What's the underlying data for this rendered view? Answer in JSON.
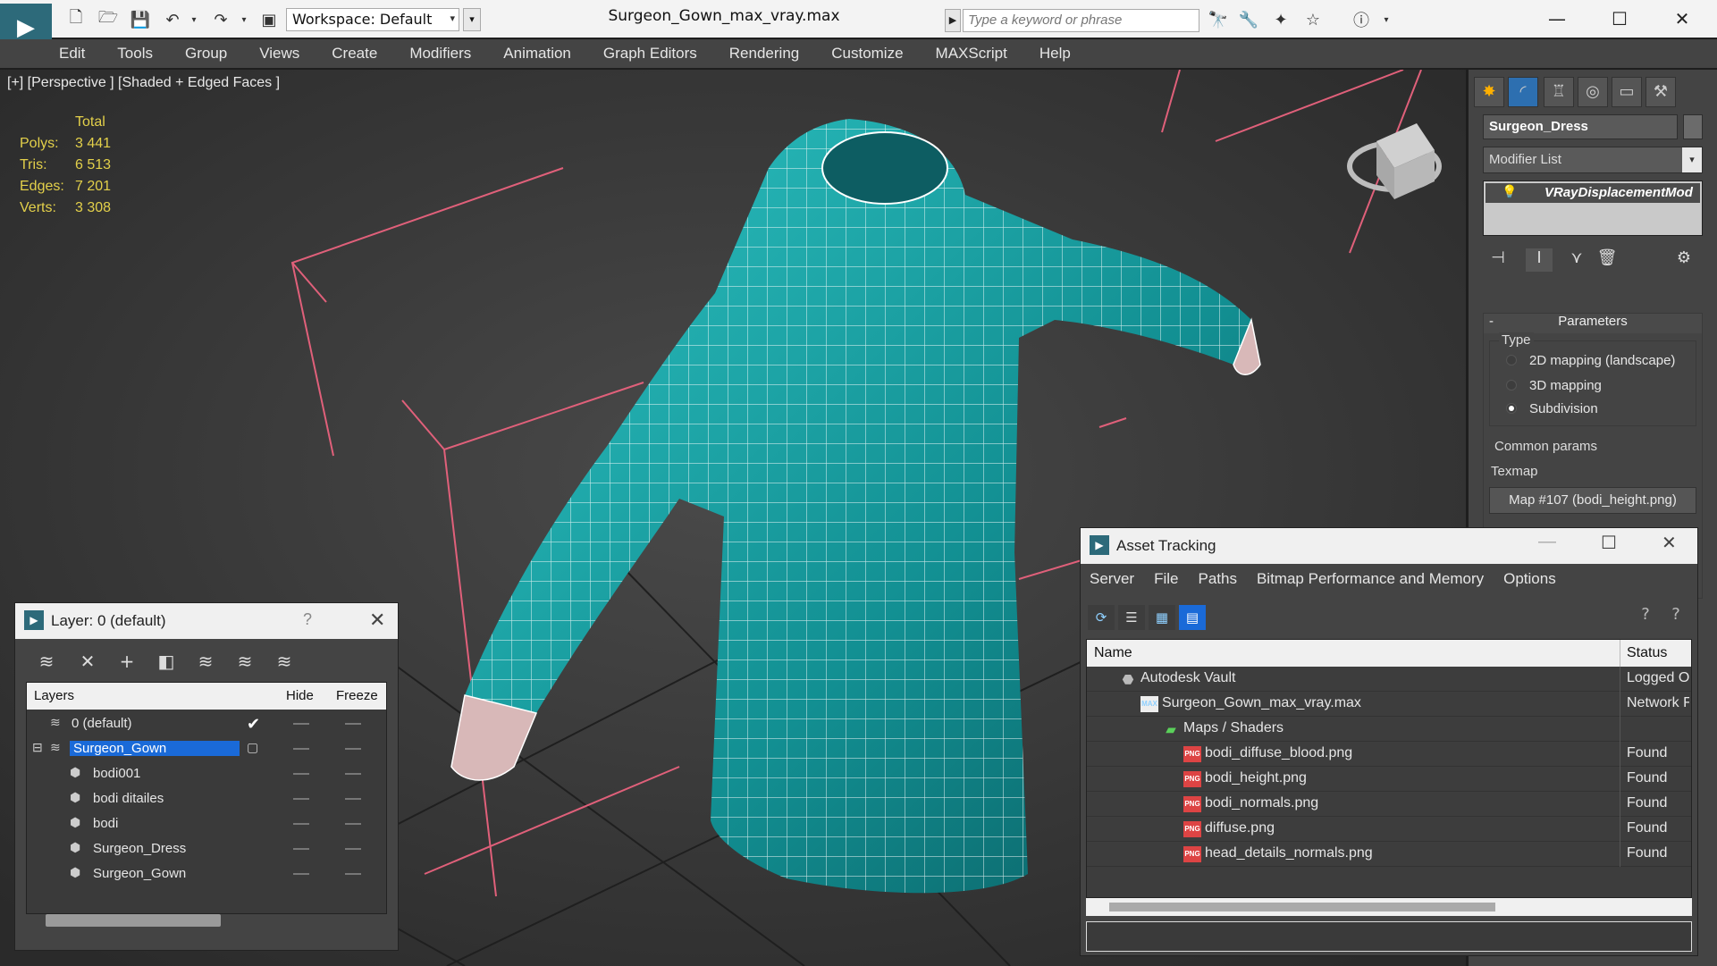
{
  "titlebar": {
    "workspace_label": "Workspace: Default",
    "document_title": "Surgeon_Gown_max_vray.max",
    "search_placeholder": "Type a keyword or phrase"
  },
  "menubar": {
    "items": [
      "Edit",
      "Tools",
      "Group",
      "Views",
      "Create",
      "Modifiers",
      "Animation",
      "Graph Editors",
      "Rendering",
      "Customize",
      "MAXScript",
      "Help"
    ]
  },
  "viewport": {
    "label": "[+] [Perspective ] [Shaded + Edged Faces ]",
    "stats": {
      "header": "Total",
      "rows": [
        {
          "label": "Polys:",
          "value": "3 441"
        },
        {
          "label": "Tris:",
          "value": "6 513"
        },
        {
          "label": "Edges:",
          "value": "7 201"
        },
        {
          "label": "Verts:",
          "value": "3 308"
        }
      ]
    },
    "mesh_color": "#1fa3a3",
    "wire_color": "#ffffff",
    "bbox_color": "#e0607a"
  },
  "command_panel": {
    "object_name": "Surgeon_Dress",
    "modifier_list": "Modifier List",
    "stack_item": "VRayDisplacementMod",
    "parameters_title": "Parameters",
    "type_label": "Type",
    "type_options": [
      {
        "label": "2D mapping (landscape)",
        "selected": false
      },
      {
        "label": "3D mapping",
        "selected": false
      },
      {
        "label": "Subdivision",
        "selected": true
      }
    ],
    "common_params": "Common params",
    "texmap_label": "Texmap",
    "map_button": "Map #107 (bodi_height.png)"
  },
  "layer_window": {
    "title": "Layer: 0 (default)",
    "help": "?",
    "columns": {
      "layers": "Layers",
      "hide": "Hide",
      "freeze": "Freeze"
    },
    "rows": [
      {
        "name": "0 (default)",
        "type": "layer",
        "indent": 1,
        "current": true,
        "selected": false
      },
      {
        "name": "Surgeon_Gown",
        "type": "layer",
        "indent": 1,
        "current": false,
        "selected": true
      },
      {
        "name": "bodi001",
        "type": "object",
        "indent": 2,
        "current": false,
        "selected": false
      },
      {
        "name": "bodi ditailes",
        "type": "object",
        "indent": 2,
        "current": false,
        "selected": false
      },
      {
        "name": "bodi",
        "type": "object",
        "indent": 2,
        "current": false,
        "selected": false
      },
      {
        "name": "Surgeon_Dress",
        "type": "object",
        "indent": 2,
        "current": false,
        "selected": false
      },
      {
        "name": "Surgeon_Gown",
        "type": "object",
        "indent": 2,
        "current": false,
        "selected": false
      }
    ]
  },
  "asset_window": {
    "title": "Asset Tracking",
    "menu": [
      "Server",
      "File",
      "Paths",
      "Bitmap Performance and Memory",
      "Options"
    ],
    "columns": {
      "name": "Name",
      "status": "Status"
    },
    "rows": [
      {
        "name": "Autodesk Vault",
        "status": "Logged O",
        "indent": 0,
        "icon": "vault"
      },
      {
        "name": "Surgeon_Gown_max_vray.max",
        "status": "Network F",
        "indent": 1,
        "icon": "max"
      },
      {
        "name": "Maps / Shaders",
        "status": "",
        "indent": 2,
        "icon": "folder"
      },
      {
        "name": "bodi_diffuse_blood.png",
        "status": "Found",
        "indent": 3,
        "icon": "png"
      },
      {
        "name": "bodi_height.png",
        "status": "Found",
        "indent": 3,
        "icon": "png"
      },
      {
        "name": "bodi_normals.png",
        "status": "Found",
        "indent": 3,
        "icon": "png"
      },
      {
        "name": "diffuse.png",
        "status": "Found",
        "indent": 3,
        "icon": "png"
      },
      {
        "name": "head_details_normals.png",
        "status": "Found",
        "indent": 3,
        "icon": "png"
      }
    ]
  }
}
